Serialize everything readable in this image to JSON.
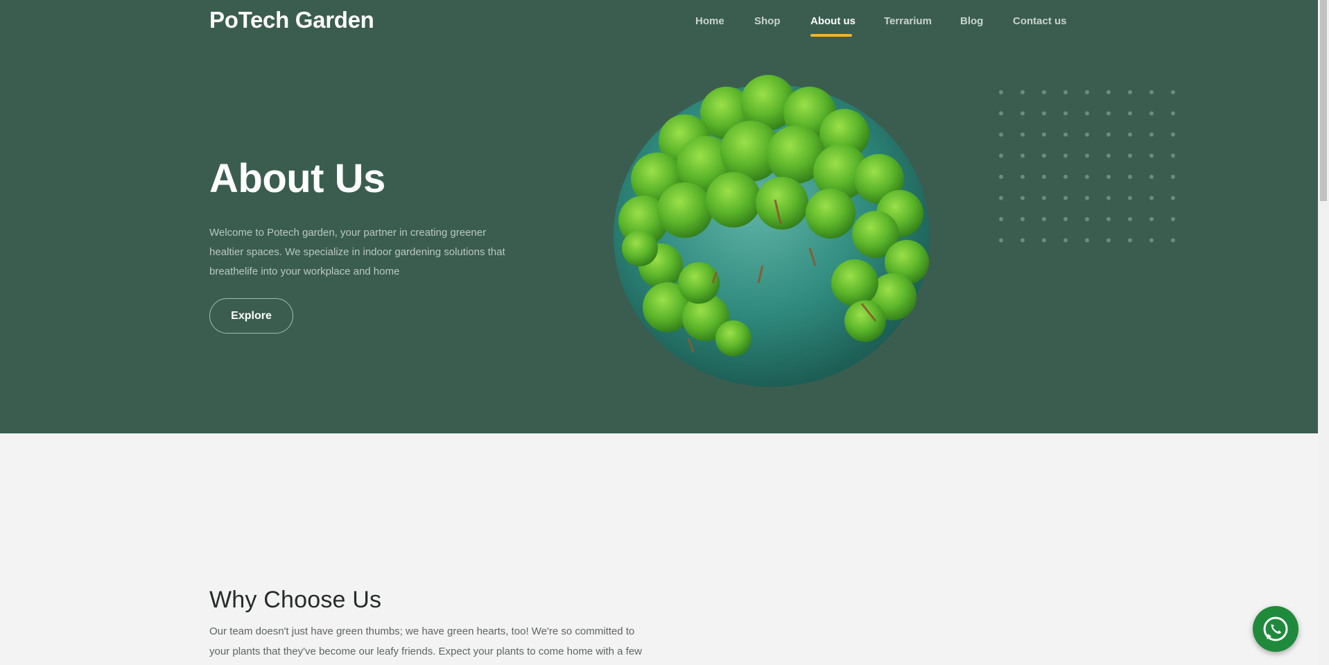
{
  "header": {
    "brand": "PoTech Garden",
    "nav": [
      "Home",
      "Shop",
      "About us",
      "Terrarium",
      "Blog",
      "Contact us"
    ],
    "active_nav": "About us"
  },
  "hero": {
    "title": "About Us",
    "description": "Welcome to Potech garden, your partner in creating greener healtier spaces. We specialize in indoor gardening solutions that breathelife into your workplace and home",
    "cta_label": "Explore",
    "image": "green-globe-with-trees"
  },
  "why": {
    "title": "Why Choose Us",
    "text": "Our team doesn't just have green thumbs; we have green hearts, too! We're so committed to your plants that they've become our leafy friends. Expect your plants to come home with a few"
  },
  "icons": {
    "floating_button": "whatsapp-icon"
  },
  "colors": {
    "hero_bg": "#3b5d4f",
    "accent": "#f2b424",
    "page_bg": "#f2f3f2",
    "whatsapp": "#1f8a3b"
  }
}
